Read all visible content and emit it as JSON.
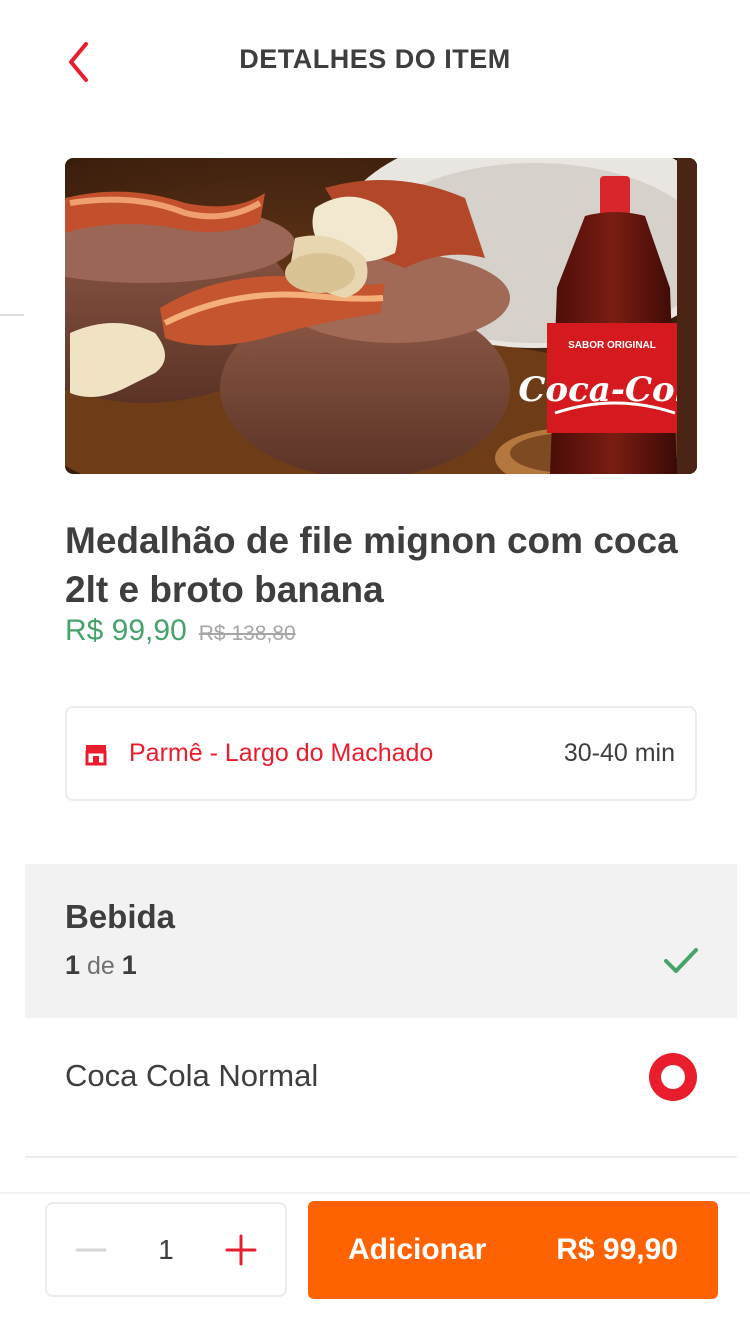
{
  "header": {
    "title": "DETALHES DO ITEM",
    "back_icon": "chevron-left-icon"
  },
  "item": {
    "name": "Medalhão de file mignon com coca 2lt e broto banana",
    "price": "R$ 99,90",
    "old_price": "R$ 138,80",
    "image_brand_text": "Coca-Cola",
    "image_bottle_label": "SABOR ORIGINAL"
  },
  "store": {
    "icon": "store-icon",
    "name": "Parmê - Largo do Machado",
    "delivery_time": "30-40 min"
  },
  "options_section": {
    "title": "Bebida",
    "count_selected": "1",
    "count_of": "de",
    "count_total": "1",
    "complete_icon": "check-icon",
    "options": [
      {
        "label": "Coca Cola Normal",
        "selected": true
      }
    ]
  },
  "footer": {
    "quantity": "1",
    "add_label": "Adicionar",
    "add_price": "R$ 99,90"
  },
  "colors": {
    "brand_red": "#ea1d2c",
    "cta_orange": "#ff6200",
    "price_green": "#48a36b",
    "text_dark": "#3e3e3e"
  }
}
